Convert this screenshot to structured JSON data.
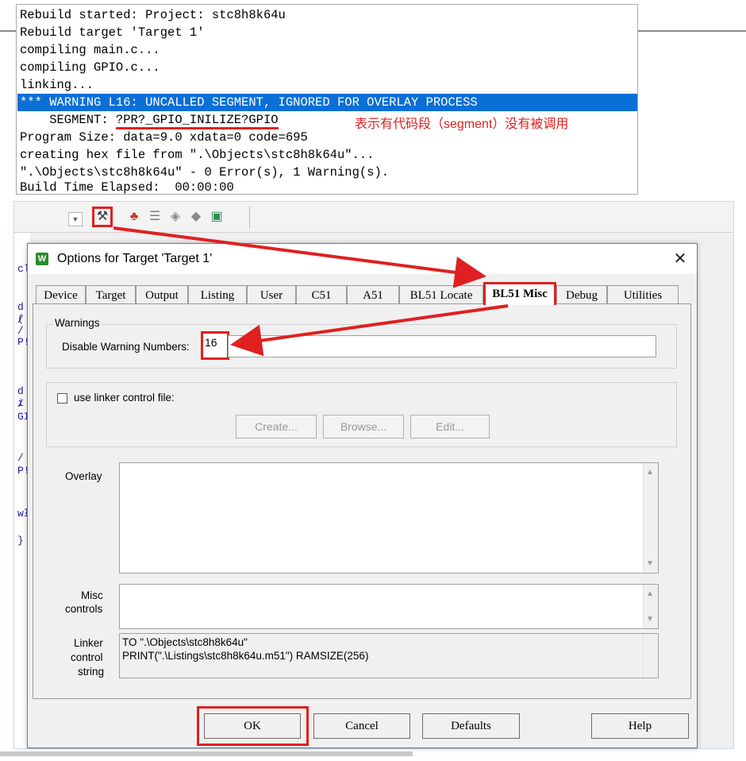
{
  "build_output": {
    "lines": [
      "Rebuild started: Project: stc8h8k64u",
      "Rebuild target 'Target 1'",
      "compiling main.c...",
      "compiling GPIO.c...",
      "linking...",
      "*** WARNING L16: UNCALLED SEGMENT, IGNORED FOR OVERLAY PROCESS",
      "    SEGMENT: ",
      "Program Size: data=9.0 xdata=0 code=695",
      "creating hex file from \".\\Objects\\stc8h8k64u\"...",
      "\".\\Objects\\stc8h8k64u\" - 0 Error(s), 1 Warning(s).",
      "Build Time Elapsed:  00:00:00"
    ],
    "segment_name": "?PR?_GPIO_INILIZE?GPIO",
    "annotation": "表示有代码段（segment）没有被调用"
  },
  "editor": {
    "lines": [
      "cl",
      "d (",
      "/",
      "/",
      "P!",
      "d i",
      "/",
      "GI",
      "/",
      "P!",
      "wł",
      "}"
    ]
  },
  "dialog": {
    "title": "Options for Target 'Target 1'",
    "icon_letter": "W",
    "close_glyph": "✕",
    "tabs": [
      "Device",
      "Target",
      "Output",
      "Listing",
      "User",
      "C51",
      "A51",
      "BL51 Locate",
      "BL51 Misc",
      "Debug",
      "Utilities"
    ],
    "active_tab": "BL51 Misc",
    "warnings": {
      "group_label": "Warnings",
      "field_label": "Disable Warning Numbers:",
      "value": "16"
    },
    "linker_file": {
      "checkbox_label": "use linker control file:",
      "checked": false,
      "create_label": "Create...",
      "browse_label": "Browse...",
      "edit_label": "Edit..."
    },
    "overlay_label": "Overlay",
    "misc_label_1": "Misc",
    "misc_label_2": "controls",
    "linker_label_1": "Linker",
    "linker_label_2": "control",
    "linker_label_3": "string",
    "linker_string_1": "TO \".\\Objects\\stc8h8k64u\"",
    "linker_string_2": "PRINT(\".\\Listings\\stc8h8k64u.m51\") RAMSIZE(256)",
    "buttons": {
      "ok": "OK",
      "cancel": "Cancel",
      "defaults": "Defaults",
      "help": "Help"
    }
  },
  "colors": {
    "highlight": "#0a6fd6",
    "annotation_red": "#e02020"
  }
}
